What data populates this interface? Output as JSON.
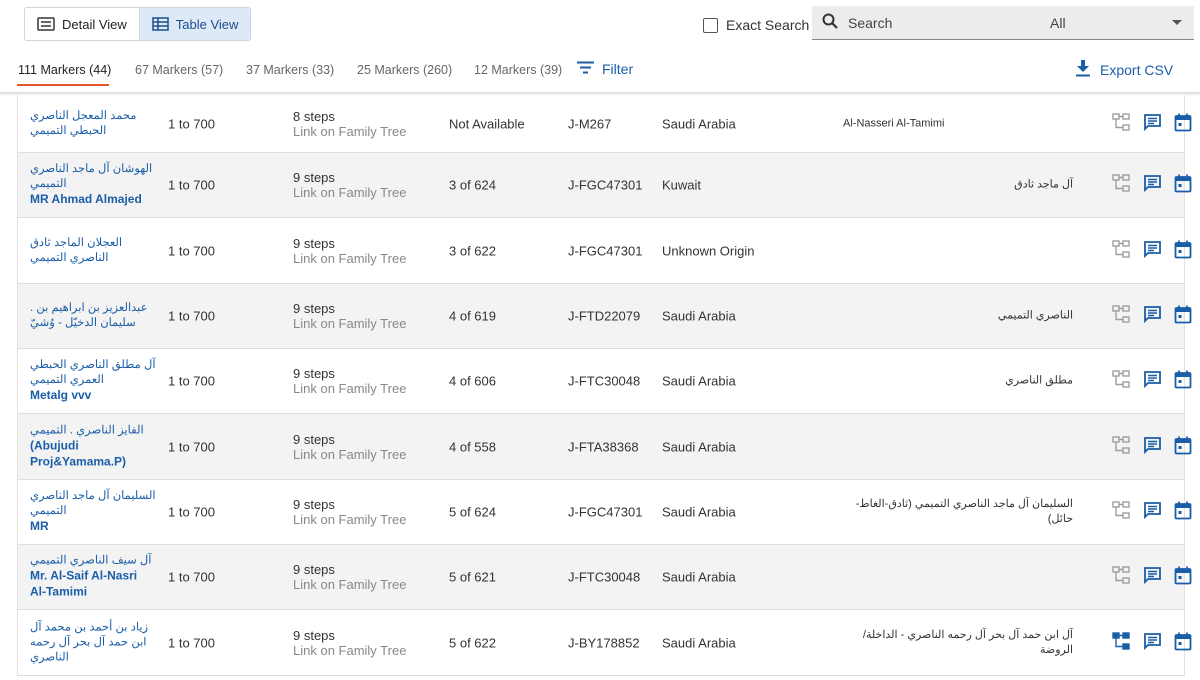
{
  "view_toggle": {
    "detail_label": "Detail View",
    "table_label": "Table View",
    "active": "table"
  },
  "exact_search": {
    "label": "Exact Search",
    "checked": false
  },
  "search": {
    "placeholder": "Search",
    "scope": "All"
  },
  "tabs": [
    {
      "label": "111 Markers (44)",
      "active": true
    },
    {
      "label": "67 Markers (57)",
      "active": false
    },
    {
      "label": "37 Markers (33)",
      "active": false
    },
    {
      "label": "25 Markers (260)",
      "active": false
    },
    {
      "label": "12 Markers (39)",
      "active": false
    }
  ],
  "filter_label": "Filter",
  "export_label": "Export CSV",
  "colors": {
    "link_blue": "#1a5ea8",
    "accent_orange": "#e8572a",
    "icon_gray": "#9e9e9e",
    "icon_blue": "#1a5ea8",
    "row_alt": "#f3f3f3"
  },
  "rows": [
    {
      "name_en": "",
      "name_ar": "محمد المعجل الناصري الحبطي التميمي",
      "range": "1 to 700",
      "steps": "8 steps",
      "link": "Link on Family Tree",
      "rank": "Not Available",
      "haplogroup": "J-M267",
      "country": "Saudi Arabia",
      "family": "Al-Nasseri Al-Tamimi",
      "tree_active": false
    },
    {
      "name_en": "MR Ahmad Almajed",
      "name_ar": "الهوشان آل ماجد الناصري التميمي",
      "range": "1 to 700",
      "steps": "9 steps",
      "link": "Link on Family Tree",
      "rank": "3 of 624",
      "haplogroup": "J-FGC47301",
      "country": "Kuwait",
      "family": "آل ماجد ثادق",
      "tree_active": false
    },
    {
      "name_en": "",
      "name_ar": "العجلان الماجد ثادق الناصري التميمي",
      "range": "1 to 700",
      "steps": "9 steps",
      "link": "Link on Family Tree",
      "rank": "3 of 622",
      "haplogroup": "J-FGC47301",
      "country": "Unknown Origin",
      "family": "",
      "tree_active": false
    },
    {
      "name_en": "",
      "name_ar": "عبدالعزيز بن ابراهيم بن . سليمان الدخيّل - وُشيّ",
      "range": "1 to 700",
      "steps": "9 steps",
      "link": "Link on Family Tree",
      "rank": "4 of 619",
      "haplogroup": "J-FTD22079",
      "country": "Saudi Arabia",
      "family": "الناصري التميمي",
      "tree_active": false
    },
    {
      "name_en": "Metalg vvv",
      "name_ar": "آل مطلق الناصري الحبطي العمري التميمي",
      "range": "1 to 700",
      "steps": "9 steps",
      "link": "Link on Family Tree",
      "rank": "4 of 606",
      "haplogroup": "J-FTC30048",
      "country": "Saudi Arabia",
      "family": "مطلق الناصري",
      "tree_active": false
    },
    {
      "name_en": "(Abujudi Proj&Yamama.P)",
      "name_ar": "الفايز الناصري . التميمي",
      "range": "1 to 700",
      "steps": "9 steps",
      "link": "Link on Family Tree",
      "rank": "4 of 558",
      "haplogroup": "J-FTA38368",
      "country": "Saudi Arabia",
      "family": "",
      "tree_active": false
    },
    {
      "name_en": "MR",
      "name_ar": "السليمان آل ماجد الناصري التميمي",
      "range": "1 to 700",
      "steps": "9 steps",
      "link": "Link on Family Tree",
      "rank": "5 of 624",
      "haplogroup": "J-FGC47301",
      "country": "Saudi Arabia",
      "family": "السليمان آل ماجد الناصري التميمي (ثادق-الغاط-حائل)",
      "tree_active": false
    },
    {
      "name_en": "Mr. Al-Saif Al-Nasri Al-Tamimi",
      "name_ar": "آل سيف الناصري التميمي",
      "range": "1 to 700",
      "steps": "9 steps",
      "link": "Link on Family Tree",
      "rank": "5 of 621",
      "haplogroup": "J-FTC30048",
      "country": "Saudi Arabia",
      "family": "",
      "tree_active": false
    },
    {
      "name_en": "",
      "name_ar": "زياد بن أحمد بن محمد آل ابن حمد آل بحر آل رحمه الناصري",
      "range": "1 to 700",
      "steps": "9 steps",
      "link": "Link on Family Tree",
      "rank": "5 of 622",
      "haplogroup": "J-BY178852",
      "country": "Saudi Arabia",
      "family": "آل ابن حمد آل بحر آل رحمه الناصري - الداخلة/الروضة",
      "tree_active": true
    }
  ]
}
